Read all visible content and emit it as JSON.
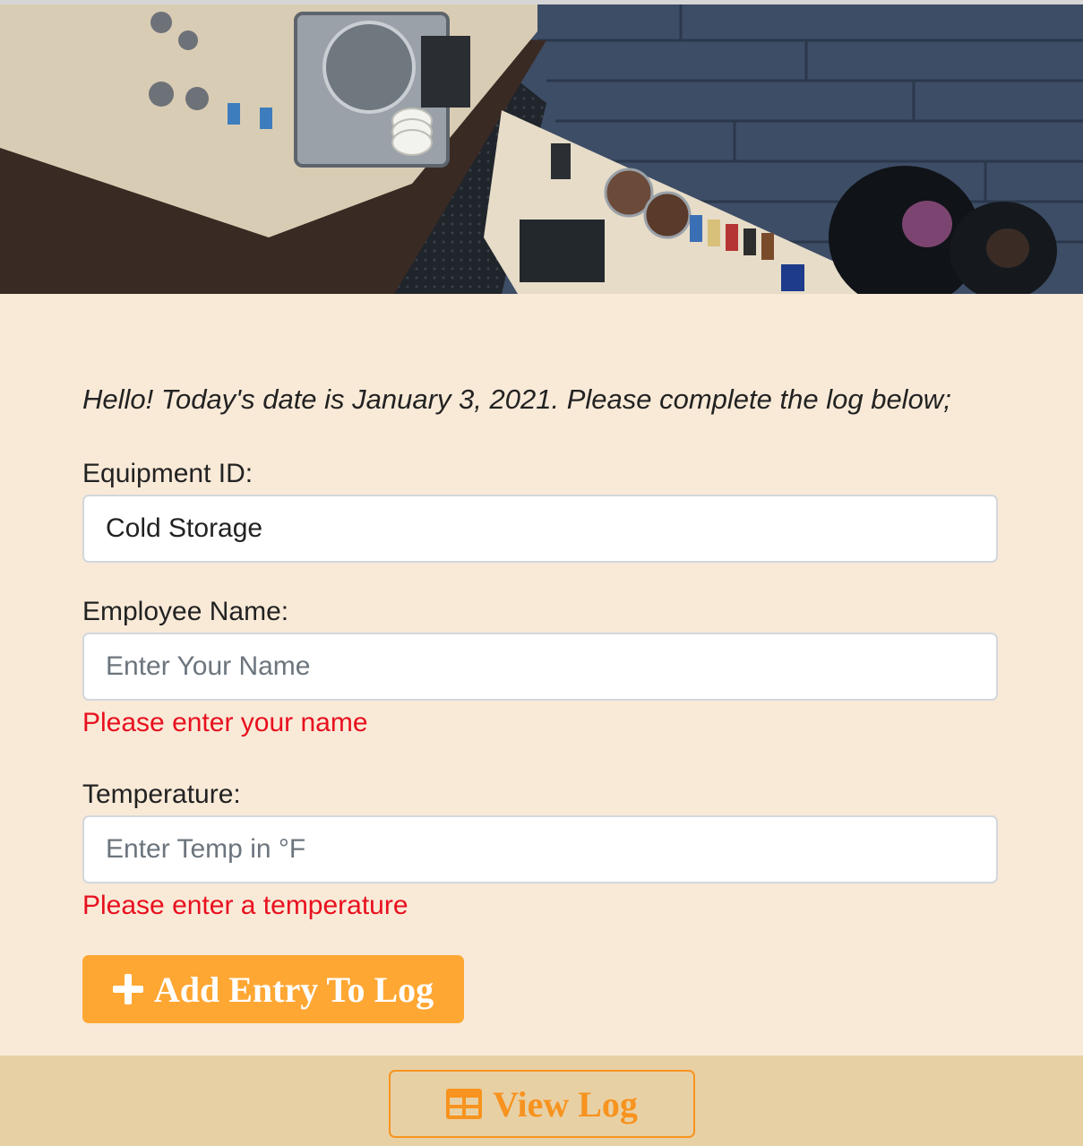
{
  "hero": {
    "alt": "Overhead view of a coffee shop counter"
  },
  "greeting": "Hello! Today's date is January 3, 2021. Please complete the log below;",
  "form": {
    "equipment": {
      "label": "Equipment ID:",
      "value": "Cold Storage"
    },
    "employee": {
      "label": "Employee Name:",
      "placeholder": "Enter Your Name",
      "error": "Please enter your name"
    },
    "temperature": {
      "label": "Temperature:",
      "placeholder": "Enter Temp in °F",
      "error": "Please enter a temperature"
    },
    "add_button": {
      "label": "Add Entry To Log",
      "icon": "plus-icon",
      "color": "#ffa733"
    }
  },
  "footer": {
    "view_button": {
      "label": "View Log",
      "icon": "table-icon",
      "color": "#f7931e"
    }
  },
  "colors": {
    "background": "#f9ead8",
    "footer_background": "#e8d0a5",
    "error": "#e8101e"
  }
}
